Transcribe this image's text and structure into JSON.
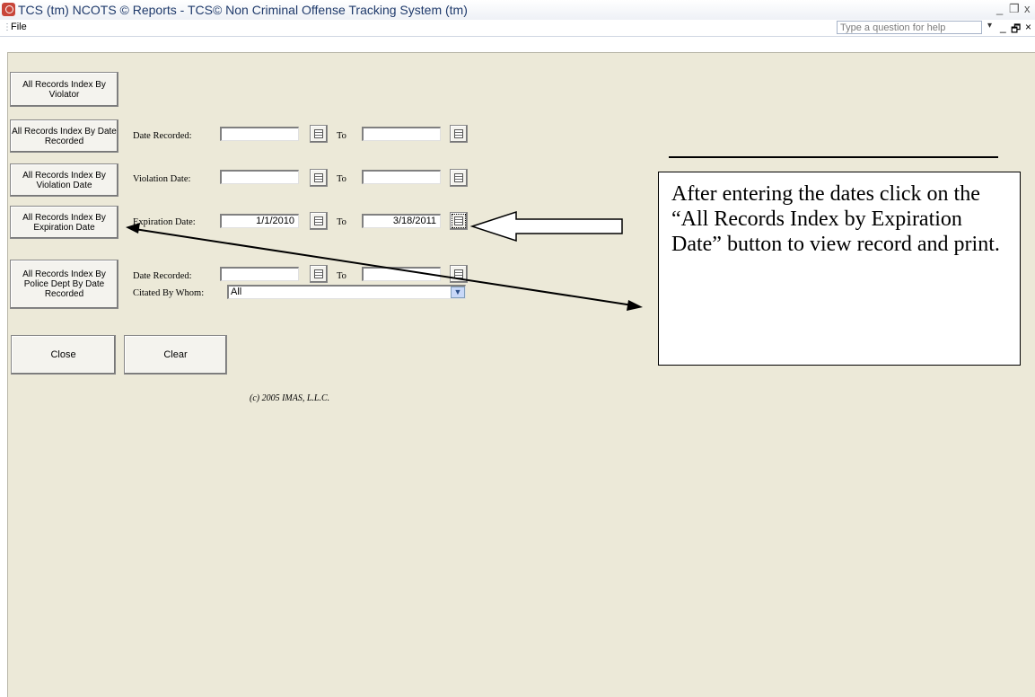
{
  "window": {
    "title": "TCS (tm) NCOTS © Reports - TCS© Non Criminal Offense Tracking System (tm)",
    "minimize": "_",
    "maximize": "❐",
    "close": "x"
  },
  "menubar": {
    "file_label": "File",
    "help_placeholder": "Type a question for help",
    "help_dropdown": "▾",
    "mdi_minimize": "_",
    "mdi_restore": "🗗",
    "mdi_close": "×"
  },
  "buttons": {
    "by_violator": "All Records Index By Violator",
    "by_date_recorded": "All Records Index By Date Recorded",
    "by_violation_date": "All Records Index By Violation Date",
    "by_expiration_date": "All Records Index By Expiration Date",
    "by_police_dept": "All Records Index By Police Dept By Date Recorded",
    "close": "Close",
    "clear": "Clear"
  },
  "rows": {
    "date_recorded": {
      "label": "Date Recorded:",
      "from": "",
      "to_label": "To",
      "to": ""
    },
    "violation_date": {
      "label": "Violation Date:",
      "from": "",
      "to_label": "To",
      "to": ""
    },
    "expiration_date": {
      "label": "Expiration Date:",
      "from": "1/1/2010",
      "to_label": "To",
      "to": "3/18/2011"
    },
    "police_date_recorded": {
      "label": "Date Recorded:",
      "from": "",
      "to_label": "To",
      "to": ""
    },
    "citated_by": {
      "label": "Citated By Whom:",
      "value": "All"
    }
  },
  "copyright": "(c) 2005 IMAS, L.L.C.",
  "callout": {
    "text": "After entering the dates click on the “All Records Index by Expiration Date” button to view record and print."
  }
}
